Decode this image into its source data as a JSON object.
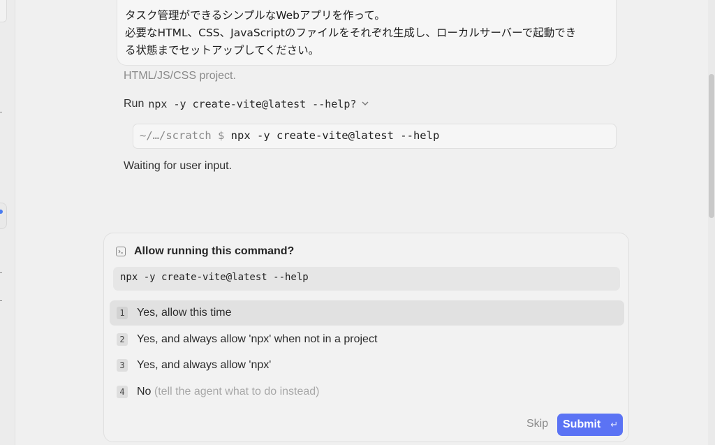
{
  "conversation": {
    "user_message": {
      "line1": "タスク管理ができるシンプルなWebアプリを作って。",
      "line2": "必要なHTML、CSS、JavaScriptのファイルをそれぞれ生成し、ローカルサーバーで起動でき",
      "line3": "る状態までセットアップしてください。"
    },
    "assistant": {
      "faded_text": "HTML/JS/CSS project.",
      "run_prefix": "Run",
      "run_command": "npx -y create-vite@latest --help?",
      "expand_icon": "chevron-down-icon",
      "terminal_path": "~/…/scratch $",
      "terminal_command": "npx -y create-vite@latest --help",
      "status": "Waiting for user input."
    }
  },
  "permission": {
    "icon": "terminal-icon",
    "title": "Allow running this command?",
    "command": "npx -y create-vite@latest --help",
    "options": [
      {
        "num": "1",
        "label": "Yes, allow this time",
        "hint": ""
      },
      {
        "num": "2",
        "label": "Yes, and always allow 'npx' when not in a project",
        "hint": ""
      },
      {
        "num": "3",
        "label": "Yes, and always allow 'npx'",
        "hint": ""
      },
      {
        "num": "4",
        "label": "No",
        "hint": "(tell the agent what to do instead)"
      }
    ],
    "selected_index": 0,
    "skip_label": "Skip",
    "submit_label": "Submit",
    "submit_icon": "enter-icon",
    "submit_glyph": "↵",
    "accent_color": "#5b73f4"
  }
}
